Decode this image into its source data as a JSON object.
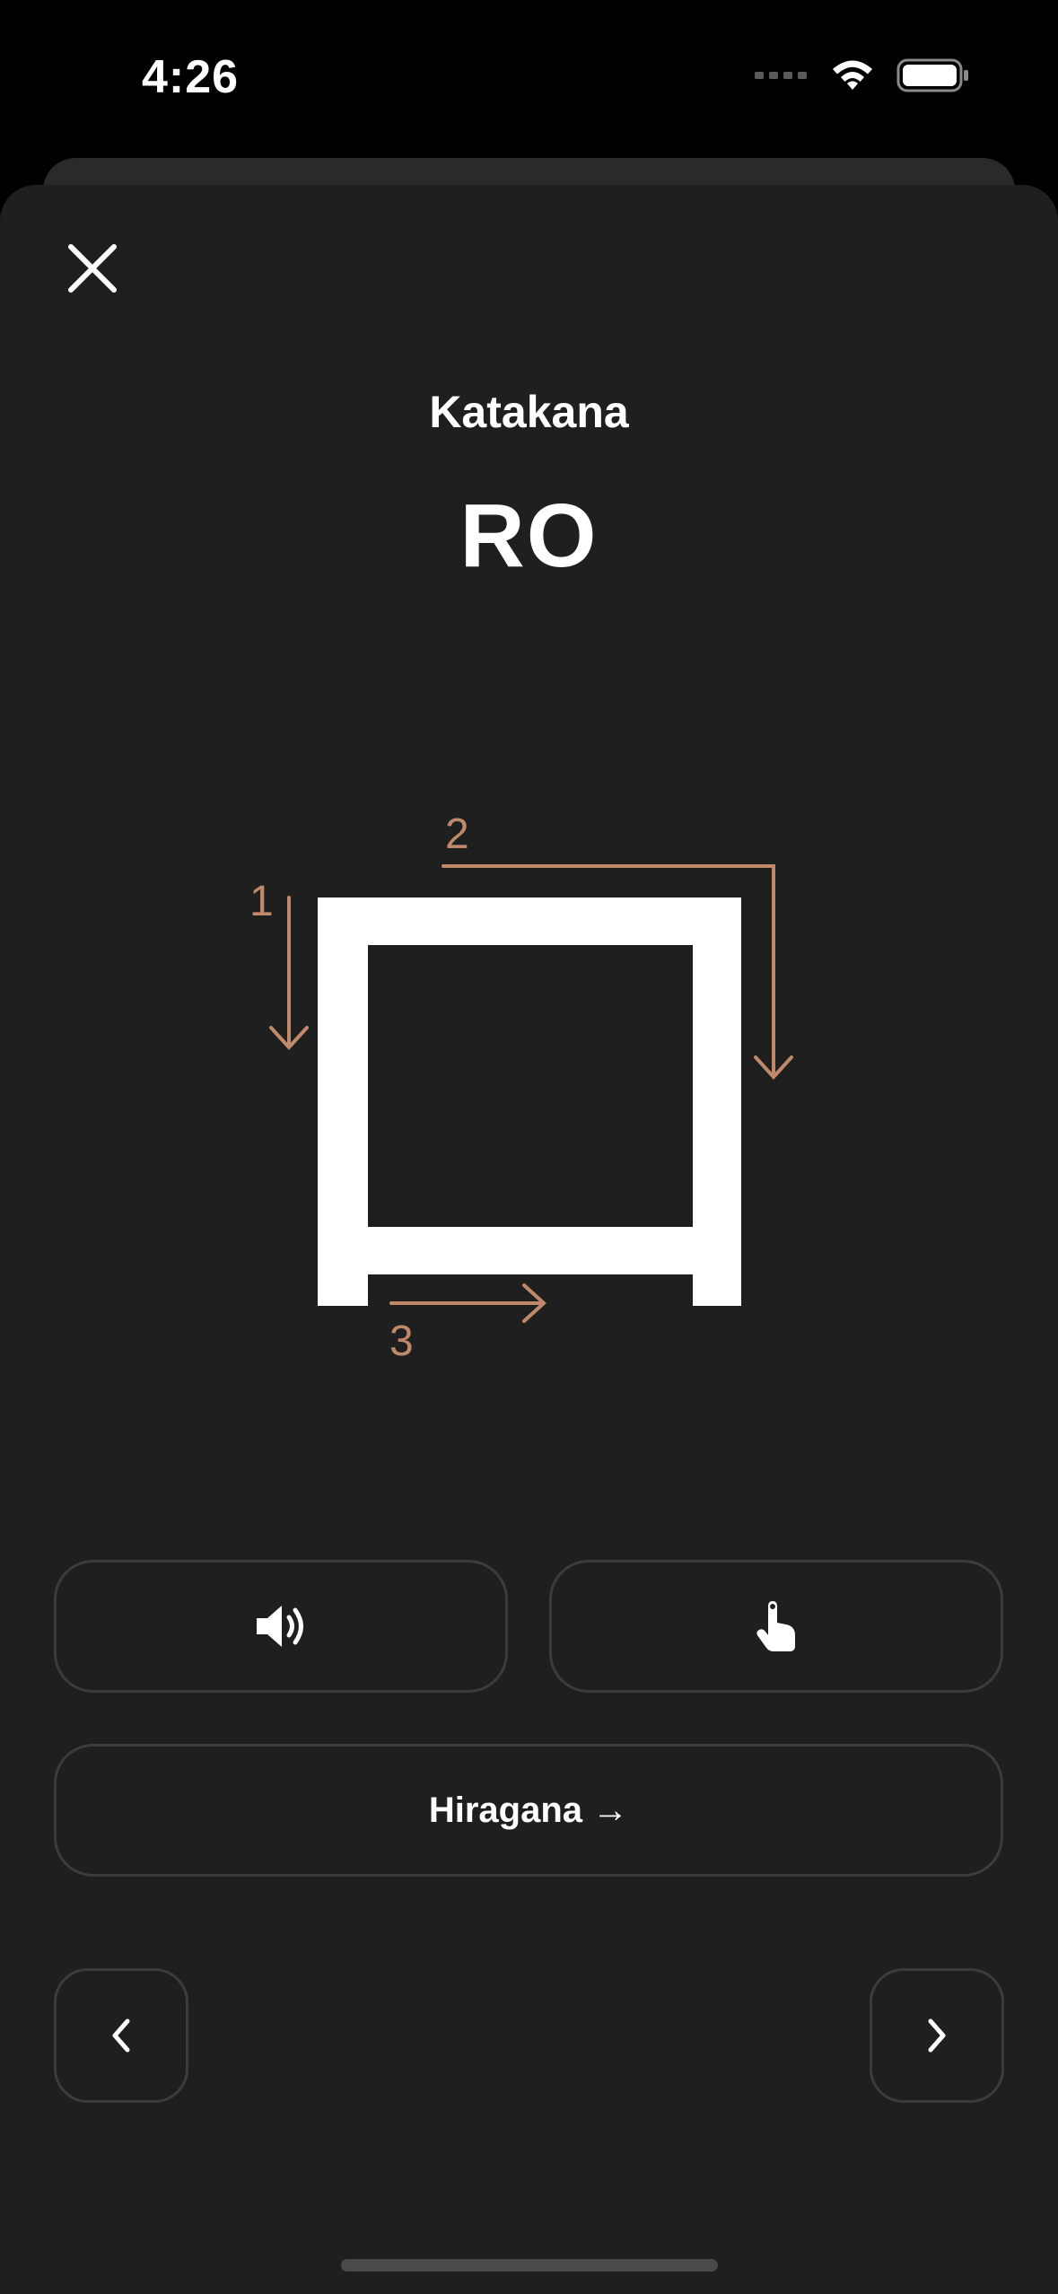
{
  "status_bar": {
    "time": "4:26",
    "icons": [
      "signal-dots-icon",
      "wifi-icon",
      "battery-icon"
    ]
  },
  "header": {
    "close_icon": "close-icon",
    "kana_type": "Katakana",
    "romaji": "RO"
  },
  "stroke_diagram": {
    "character": "ロ",
    "stroke_numbers": [
      "1",
      "2",
      "3"
    ],
    "accent_color": "#c08a6a",
    "glyph_color": "#ffffff"
  },
  "actions": {
    "sound_icon": "speaker-icon",
    "tap_icon": "hand-tap-icon",
    "switch_label": "Hiragana →"
  },
  "navigation": {
    "prev_icon": "chevron-left-icon",
    "next_icon": "chevron-right-icon"
  },
  "colors": {
    "background": "#1f1f1f",
    "button_border": "#3c3c3c",
    "accent": "#c08a6a"
  }
}
